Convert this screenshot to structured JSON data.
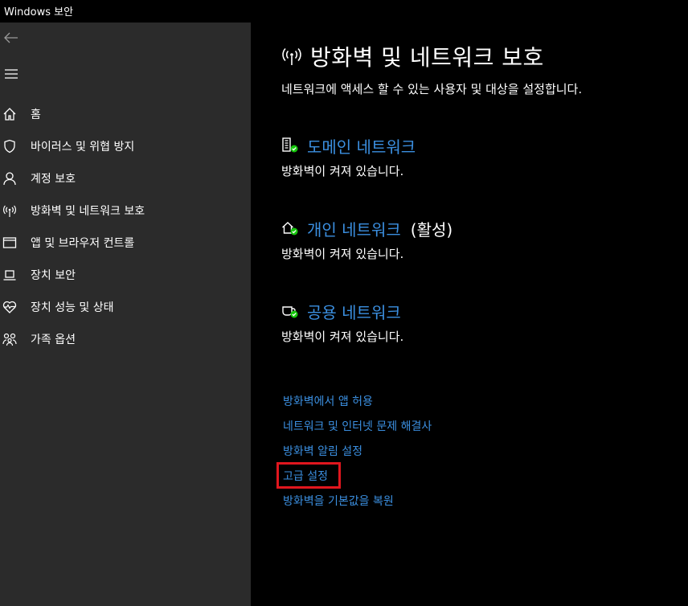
{
  "window": {
    "title": "Windows 보안"
  },
  "sidebar": {
    "back_icon": "arrow-left-icon",
    "menu_icon": "hamburger-icon",
    "items": [
      {
        "label": "홈",
        "icon": "home-icon"
      },
      {
        "label": "바이러스 및 위협 방지",
        "icon": "shield-icon"
      },
      {
        "label": "계정 보호",
        "icon": "person-icon"
      },
      {
        "label": "방화벽 및 네트워크 보호",
        "icon": "antenna-icon"
      },
      {
        "label": "앱 및 브라우저 컨트롤",
        "icon": "browser-window-icon"
      },
      {
        "label": "장치 보안",
        "icon": "laptop-icon"
      },
      {
        "label": "장치 성능 및 상태",
        "icon": "heart-pulse-icon"
      },
      {
        "label": "가족 옵션",
        "icon": "family-icon"
      }
    ]
  },
  "main": {
    "title": "방화벽 및 네트워크 보호",
    "subtitle": "네트워크에 액세스 할 수 있는 사용자 및 대상을 설정합니다.",
    "networks": [
      {
        "name": "도메인 네트워크",
        "status": "방화벽이 켜져 있습니다.",
        "active_label": "",
        "icon": "domain-network-icon"
      },
      {
        "name": "개인 네트워크",
        "status": "방화벽이 켜져 있습니다.",
        "active_label": "(활성)",
        "icon": "private-network-icon"
      },
      {
        "name": "공용 네트워크",
        "status": "방화벽이 켜져 있습니다.",
        "active_label": "",
        "icon": "public-network-icon"
      }
    ],
    "links": [
      "방화벽에서 앱 허용",
      "네트워크 및 인터넷 문제 해결사",
      "방화벽 알림 설정",
      "고급 설정",
      "방화벽을 기본값을 복원"
    ]
  },
  "colors": {
    "link": "#3b8fe0",
    "check": "#16c60c",
    "highlight": "#e0161e",
    "sidebar_bg": "#2b2b2b"
  }
}
